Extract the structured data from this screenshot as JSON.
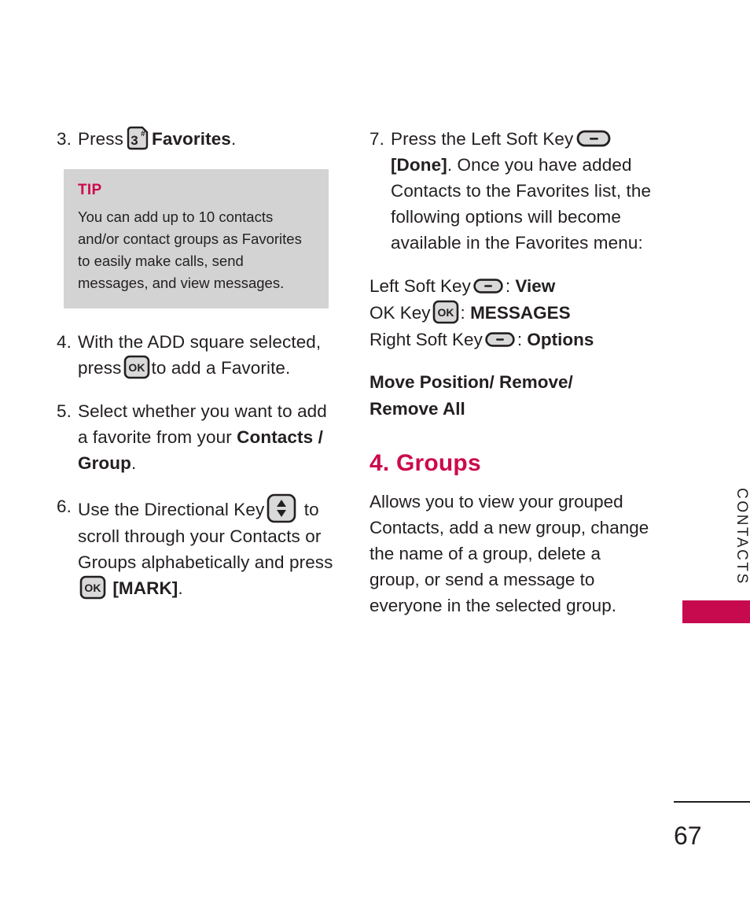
{
  "page": {
    "number": "67",
    "side_tab": "CONTACTS",
    "accent_color": "#cc0a4c",
    "tip_bg_color": "#d3d3d3"
  },
  "left_column": {
    "step3": {
      "number": "3.",
      "text_before": "Press",
      "key_label": "3",
      "key_sup": "#",
      "bold_text": "Favorites",
      "text_after": "."
    },
    "tip": {
      "title": "TIP",
      "body": "You can add up to 10 contacts and/or contact groups as Favorites to easily make calls, send messages, and view messages."
    },
    "step4": {
      "number": "4.",
      "part1": "With the ADD square selected, press",
      "key_label": "OK",
      "part2": "to add a Favorite."
    },
    "step5": {
      "number": "5.",
      "part1": "Select whether you want to add a favorite from your",
      "bold_text": "Contacts / Group",
      "part2": "."
    },
    "step6": {
      "number": "6.",
      "part1": "Use the Directional Key",
      "part2": "to scroll through your Contacts or Groups alphabetically and press",
      "key_label": "OK",
      "bold_text": "[MARK]",
      "part3": "."
    }
  },
  "right_column": {
    "step7": {
      "number": "7.",
      "part1": "Press the Left Soft Key",
      "bold_text": "[Done]",
      "part2": ". Once you have added Contacts to the Favorites list, the following options will become available in the Favorites menu:"
    },
    "softkeys": [
      {
        "label": "Left Soft Key",
        "icon": "soft-key-pill-icon",
        "separator": ":",
        "value": "View"
      },
      {
        "label": "OK Key",
        "icon": "ok-key-icon",
        "separator": ":",
        "value": "MESSAGES"
      },
      {
        "label": "Right Soft Key",
        "icon": "soft-key-pill-icon",
        "separator": ":",
        "value": "Options"
      }
    ],
    "options_line1": "Move Position/ Remove/",
    "options_line2": "Remove All",
    "section": {
      "heading": "4. Groups",
      "body": "Allows you to view your grouped Contacts, add a new group, change the name of a group, delete a group, or send a message to everyone in the selected group."
    }
  }
}
